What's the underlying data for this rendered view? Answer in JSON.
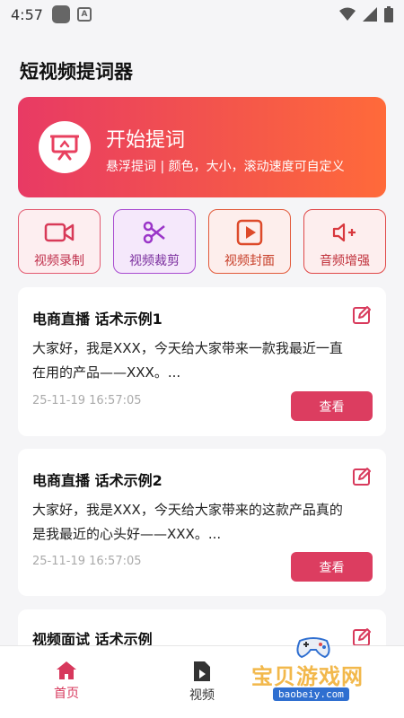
{
  "status_bar": {
    "time": "4:57"
  },
  "page_title": "短视频提词器",
  "hero": {
    "title": "开始提词",
    "subtitle": "悬浮提词 | 颜色，大小，滚动速度可自定义",
    "colors": {
      "from": "#e83a64",
      "to": "#ff6a3a"
    }
  },
  "tools": [
    {
      "label": "视频录制",
      "icon": "video-camera-icon"
    },
    {
      "label": "视频裁剪",
      "icon": "scissors-icon"
    },
    {
      "label": "视频封面",
      "icon": "play-frame-icon"
    },
    {
      "label": "音频增强",
      "icon": "speaker-plus-icon"
    }
  ],
  "scripts": [
    {
      "title": "电商直播 话术示例1",
      "line1": "大家好，我是XXX，今天给大家带来一款我最近一直",
      "line2": "在用的产品——XXX。...",
      "time": "25-11-19 16:57:05",
      "button": "查看"
    },
    {
      "title": "电商直播 话术示例2",
      "line1": "大家好，我是XXX，今天给大家带来的这款产品真的",
      "line2": "是我最近的心头好——XXX。...",
      "time": "25-11-19 16:57:05",
      "button": "查看"
    },
    {
      "title": "视频面试 话术示例"
    }
  ],
  "nav": [
    {
      "label": "首页",
      "icon": "home-icon",
      "active": true
    },
    {
      "label": "视频",
      "icon": "video-file-icon",
      "active": false
    }
  ],
  "watermark": {
    "text": "宝贝游戏网",
    "url": "baobeiy.com"
  },
  "colors": {
    "accent": "#dc3d60",
    "active_nav": "#d7385c"
  }
}
